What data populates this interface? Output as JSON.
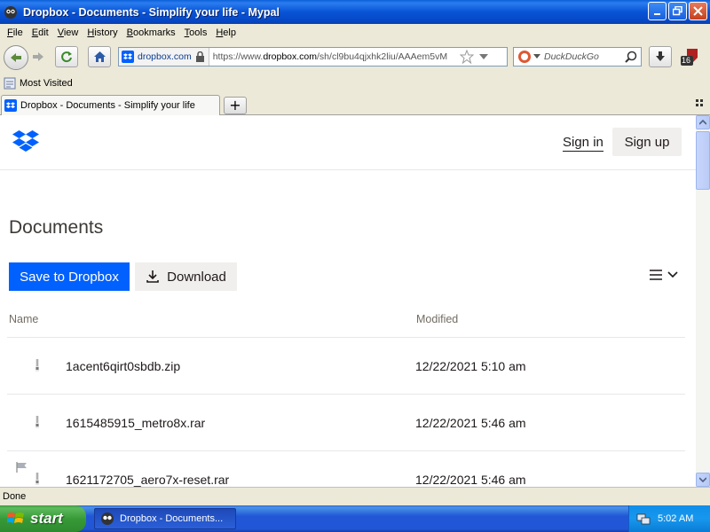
{
  "window": {
    "title": "Dropbox - Documents - Simplify your life - Mypal"
  },
  "menu": [
    "File",
    "Edit",
    "View",
    "History",
    "Bookmarks",
    "Tools",
    "Help"
  ],
  "navbar": {
    "site_identity": "dropbox.com",
    "url_prefix": "https://www.",
    "url_domain": "dropbox.com",
    "url_path": "/sh/cl9bu4qjxhk2liu/AAAem5vM",
    "search_placeholder": "DuckDuckGo",
    "badge_count": "16"
  },
  "bookmarks": {
    "most_visited": "Most Visited"
  },
  "tab": {
    "label": "Dropbox - Documents - Simplify your life",
    "new_tab": "+"
  },
  "page": {
    "sign_in": "Sign in",
    "sign_up": "Sign up",
    "title": "Documents",
    "save_button": "Save to Dropbox",
    "download_button": "Download",
    "columns": {
      "name": "Name",
      "modified": "Modified"
    },
    "files": [
      {
        "name": "1acent6qirt0sbdb.zip",
        "modified": "12/22/2021 5:10 am"
      },
      {
        "name": "1615485915_metro8x.rar",
        "modified": "12/22/2021 5:46 am"
      },
      {
        "name": "1621172705_aero7x-reset.rar",
        "modified": "12/22/2021 5:46 am"
      }
    ]
  },
  "status": "Done",
  "taskbar": {
    "start": "start",
    "task": "Dropbox - Documents...",
    "clock": "5:02 AM"
  },
  "colors": {
    "dropbox_blue": "#0061fe",
    "xp_titlebar": "#0854d6",
    "xp_start_green": "#379a37"
  }
}
